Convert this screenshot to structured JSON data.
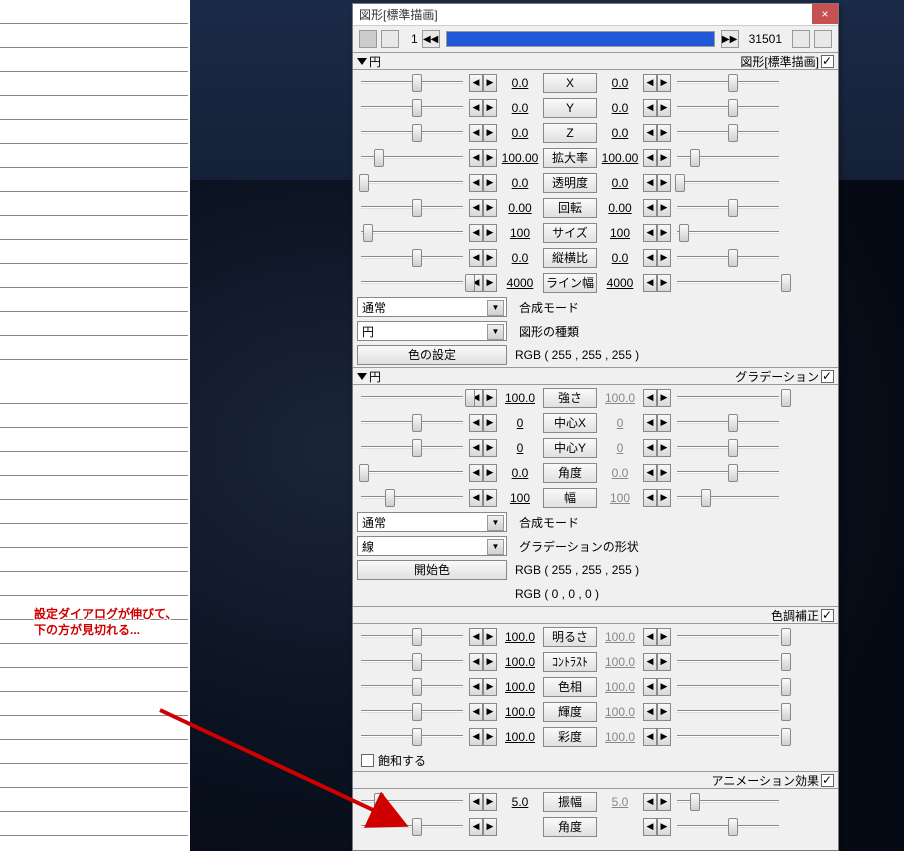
{
  "window": {
    "title": "図形[標準描画]",
    "close": "×"
  },
  "toolbar": {
    "frame_cur": "1",
    "frame_total": "31501"
  },
  "section1": {
    "name": "円",
    "right_label": "図形[標準描画]",
    "params": [
      {
        "lv": "0.0",
        "label": "X",
        "rv": "0.0",
        "lp": 50,
        "rp": 50
      },
      {
        "lv": "0.0",
        "label": "Y",
        "rv": "0.0",
        "lp": 50,
        "rp": 50
      },
      {
        "lv": "0.0",
        "label": "Z",
        "rv": "0.0",
        "lp": 50,
        "rp": 50
      },
      {
        "lv": "100.00",
        "label": "拡大率",
        "rv": "100.00",
        "lp": 15,
        "rp": 15
      },
      {
        "lv": "0.0",
        "label": "透明度",
        "rv": "0.0",
        "lp": 2,
        "rp": 2
      },
      {
        "lv": "0.00",
        "label": "回転",
        "rv": "0.00",
        "lp": 50,
        "rp": 50
      },
      {
        "lv": "100",
        "label": "サイズ",
        "rv": "100",
        "lp": 5,
        "rp": 5
      },
      {
        "lv": "0.0",
        "label": "縦横比",
        "rv": "0.0",
        "lp": 50,
        "rp": 50
      },
      {
        "lv": "4000",
        "label": "ライン幅",
        "rv": "4000",
        "lp": 98,
        "rp": 98
      }
    ],
    "dd1": {
      "value": "通常",
      "label": "合成モード"
    },
    "dd2": {
      "value": "円",
      "label": "図形の種類"
    },
    "color_btn": "色の設定",
    "rgb": "RGB ( 255 , 255 , 255 )"
  },
  "section2": {
    "name": "円",
    "right_label": "グラデーション",
    "params": [
      {
        "lv": "100.0",
        "label": "強さ",
        "rv": "100.0",
        "lp": 98,
        "rp": 98
      },
      {
        "lv": "0",
        "label": "中心X",
        "rv": "0",
        "lp": 50,
        "rp": 50
      },
      {
        "lv": "0",
        "label": "中心Y",
        "rv": "0",
        "lp": 50,
        "rp": 50
      },
      {
        "lv": "0.0",
        "label": "角度",
        "rv": "0.0",
        "lp": 2,
        "rp": 50
      },
      {
        "lv": "100",
        "label": "幅",
        "rv": "100",
        "lp": 25,
        "rp": 25
      }
    ],
    "dd1": {
      "value": "通常",
      "label": "合成モード"
    },
    "dd2": {
      "value": "線",
      "label": "グラデーションの形状"
    },
    "color_btn": "開始色",
    "rgb1": "RGB ( 255 , 255 , 255 )",
    "rgb2": "RGB ( 0 , 0 , 0 )"
  },
  "section3": {
    "right_label": "色調補正",
    "params": [
      {
        "lv": "100.0",
        "label": "明るさ",
        "rv": "100.0",
        "lp": 50,
        "rp": 98
      },
      {
        "lv": "100.0",
        "label": "ｺﾝﾄﾗｽﾄ",
        "rv": "100.0",
        "lp": 50,
        "rp": 98
      },
      {
        "lv": "100.0",
        "label": "色相",
        "rv": "100.0",
        "lp": 50,
        "rp": 98
      },
      {
        "lv": "100.0",
        "label": "輝度",
        "rv": "100.0",
        "lp": 50,
        "rp": 98
      },
      {
        "lv": "100.0",
        "label": "彩度",
        "rv": "100.0",
        "lp": 50,
        "rp": 98
      }
    ],
    "check_label": "飽和する"
  },
  "section4": {
    "right_label": "アニメーション効果",
    "params": [
      {
        "lv": "5.0",
        "label": "振幅",
        "rv": "5.0",
        "lp": 15,
        "rp": 15
      },
      {
        "lv": "",
        "label": "角度",
        "rv": "",
        "lp": 50,
        "rp": 50
      }
    ]
  },
  "annotation": {
    "line1": "設定ダイアログが伸びて、",
    "line2": "下の方が見切れる..."
  }
}
